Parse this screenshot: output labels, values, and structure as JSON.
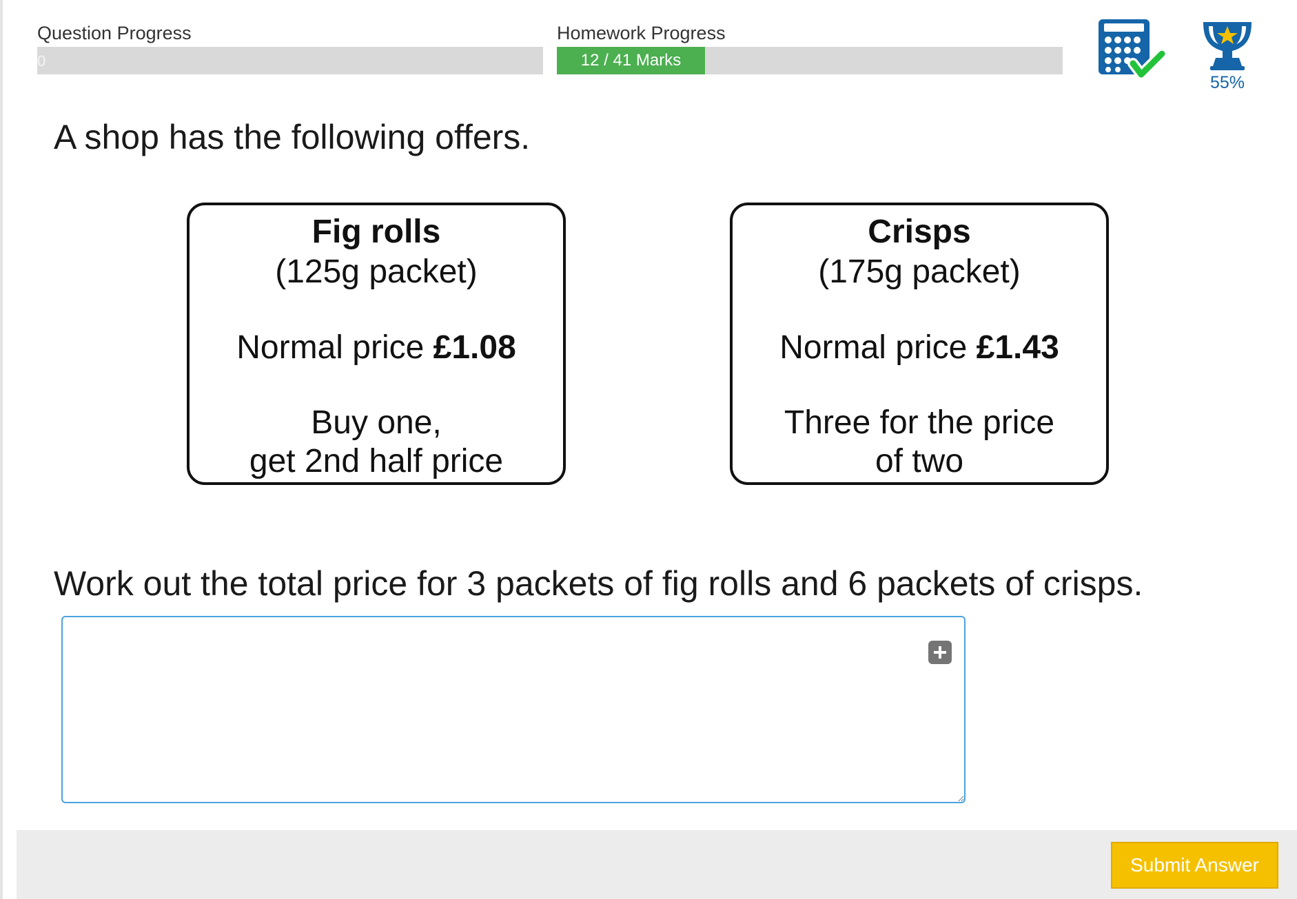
{
  "header": {
    "question_progress": {
      "label": "Question Progress",
      "value_text": "0",
      "fraction": 0
    },
    "homework_progress": {
      "label": "Homework Progress",
      "value_text": "12 / 41 Marks",
      "marks": 12,
      "total": 41
    },
    "calculator_icon": "calculator-check-icon",
    "trophy": {
      "icon": "trophy-icon",
      "percent_text": "55%"
    }
  },
  "question": {
    "intro": "A shop has the following offers.",
    "offers": [
      {
        "name": "Fig rolls",
        "size": "(125g packet)",
        "price_prefix": "Normal price ",
        "price": "£1.08",
        "deal_line1": "Buy one,",
        "deal_line2": "get 2nd half price"
      },
      {
        "name": "Crisps",
        "size": "(175g packet)",
        "price_prefix": "Normal price ",
        "price": "£1.43",
        "deal_line1": "Three for the price",
        "deal_line2": "of two"
      }
    ],
    "task": "Work out the total price for 3 packets of fig rolls and 6 packets of crisps.",
    "answer_value": ""
  },
  "footer": {
    "submit_label": "Submit Answer"
  },
  "colors": {
    "progress_fill": "#4caf50",
    "progress_track": "#d9d9d9",
    "icon_blue": "#1565a8",
    "check_green": "#22c33a",
    "trophy_star": "#f5c000",
    "submit": "#f5c000",
    "answer_border": "#4aa3df"
  }
}
